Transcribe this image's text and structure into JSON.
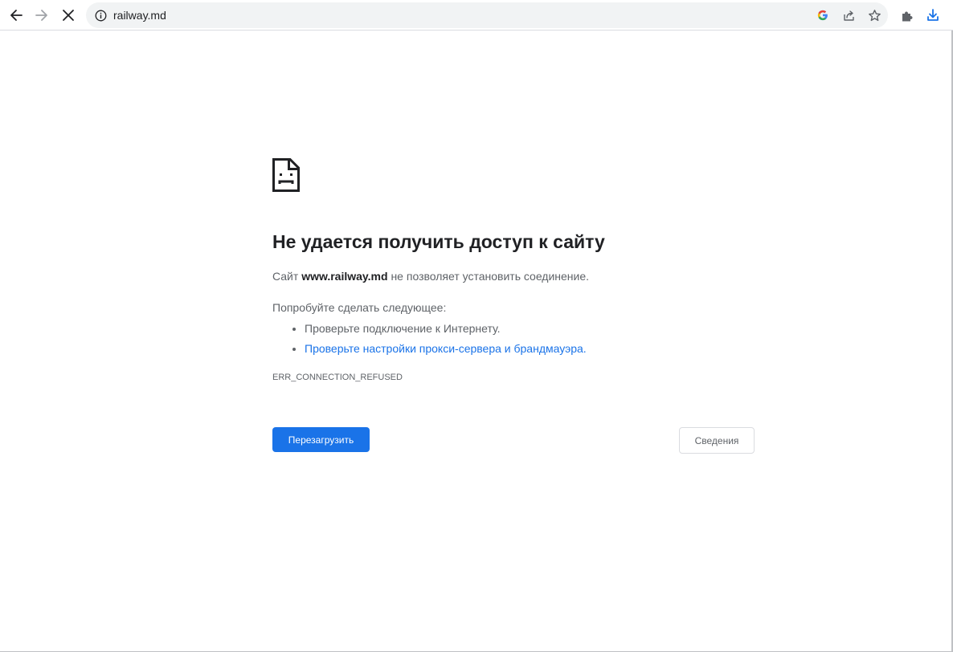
{
  "browser": {
    "url": "railway.md",
    "icons": {
      "back": "arrow-left-icon",
      "forward": "arrow-right-icon",
      "stop": "close-icon",
      "info": "info-icon",
      "google": "google-g-icon",
      "share": "share-icon",
      "bookmark": "star-icon",
      "extensions": "puzzle-icon",
      "download": "download-icon"
    }
  },
  "error_page": {
    "title": "Не удается получить доступ к сайту",
    "description": {
      "prefix": "Сайт ",
      "host": "www.railway.md",
      "suffix": " не позволяет установить соединение."
    },
    "suggestions_heading": "Попробуйте сделать следующее:",
    "suggestions": [
      "Проверьте подключение к Интернету.",
      "Проверьте настройки прокси-сервера и брандмауэра."
    ],
    "error_code": "ERR_CONNECTION_REFUSED",
    "reload_label": "Перезагрузить",
    "details_label": "Сведения"
  },
  "colors": {
    "accent": "#1a73e8",
    "text_primary": "#202124",
    "text_secondary": "#5f6368",
    "omnibox_bg": "#f1f3f4"
  }
}
